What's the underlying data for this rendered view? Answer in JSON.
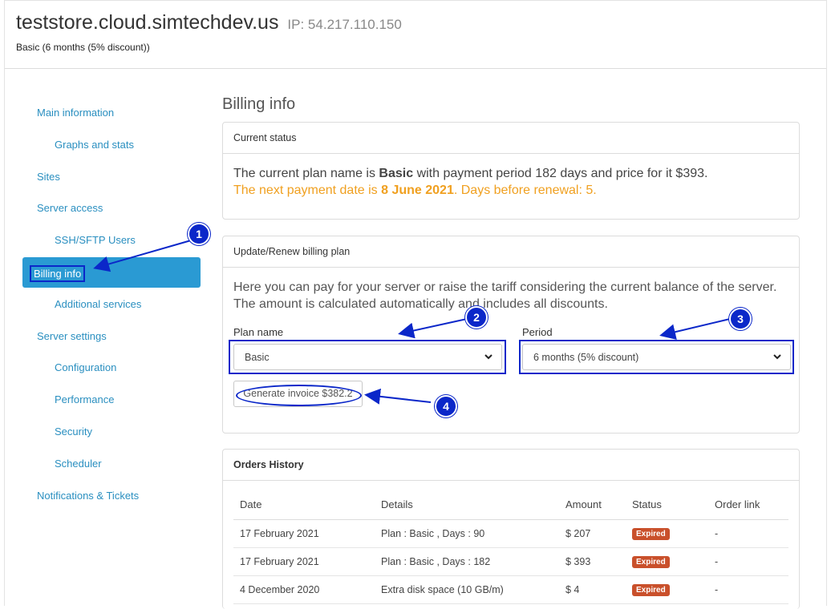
{
  "header": {
    "hostname": "teststore.cloud.simtechdev.us",
    "ip_label": "IP: 54.217.110.150",
    "plan": "Basic (6 months (5% discount))"
  },
  "sidebar": {
    "items": [
      {
        "label": "Main information"
      },
      {
        "label": "Graphs and stats"
      },
      {
        "label": "Sites"
      },
      {
        "label": "Server access"
      },
      {
        "label": "SSH/SFTP Users"
      },
      {
        "label": "Billing info",
        "active": true
      },
      {
        "label": "Additional services"
      },
      {
        "label": "Server settings"
      },
      {
        "label": "Configuration"
      },
      {
        "label": "Performance"
      },
      {
        "label": "Security"
      },
      {
        "label": "Scheduler"
      },
      {
        "label": "Notifications & Tickets"
      }
    ]
  },
  "main": {
    "title": "Billing info",
    "current_status": {
      "heading": "Current status",
      "line1_prefix": "The current plan name is ",
      "line1_plan": "Basic",
      "line1_suffix": " with payment period 182 days and price for it $393.",
      "line2_prefix": "The next payment date is ",
      "line2_date": "8 June 2021",
      "line2_suffix": ". Days before renewal: 5."
    },
    "update_plan": {
      "heading": "Update/Renew billing plan",
      "description": "Here you can pay for your server or raise the tariff considering the current balance of the server. The amount is calculated automatically and includes all discounts.",
      "plan_label": "Plan name",
      "plan_value": "Basic",
      "period_label": "Period",
      "period_value": "6 months (5% discount)",
      "generate_button": "Generate invoice $382.2"
    },
    "orders": {
      "heading": "Orders History",
      "columns": [
        "Date",
        "Details",
        "Amount",
        "Status",
        "Order link"
      ],
      "rows": [
        {
          "date": "17 February 2021",
          "details": "Plan : Basic , Days : 90",
          "amount": "$ 207",
          "status": "Expired",
          "link": "-"
        },
        {
          "date": "17 February 2021",
          "details": "Plan : Basic , Days : 182",
          "amount": "$ 393",
          "status": "Expired",
          "link": "-"
        },
        {
          "date": "4 December 2020",
          "details": "Extra disk space (10 GB/m)",
          "amount": "$ 4",
          "status": "Expired",
          "link": "-"
        }
      ]
    }
  },
  "annotations": {
    "markers": [
      "1",
      "2",
      "3",
      "4"
    ],
    "color": "#0b27c9"
  },
  "colors": {
    "link": "#2a8fc0",
    "active_bg": "#2a9ad3",
    "warning": "#f0a020",
    "badge_expired": "#c9502b"
  }
}
